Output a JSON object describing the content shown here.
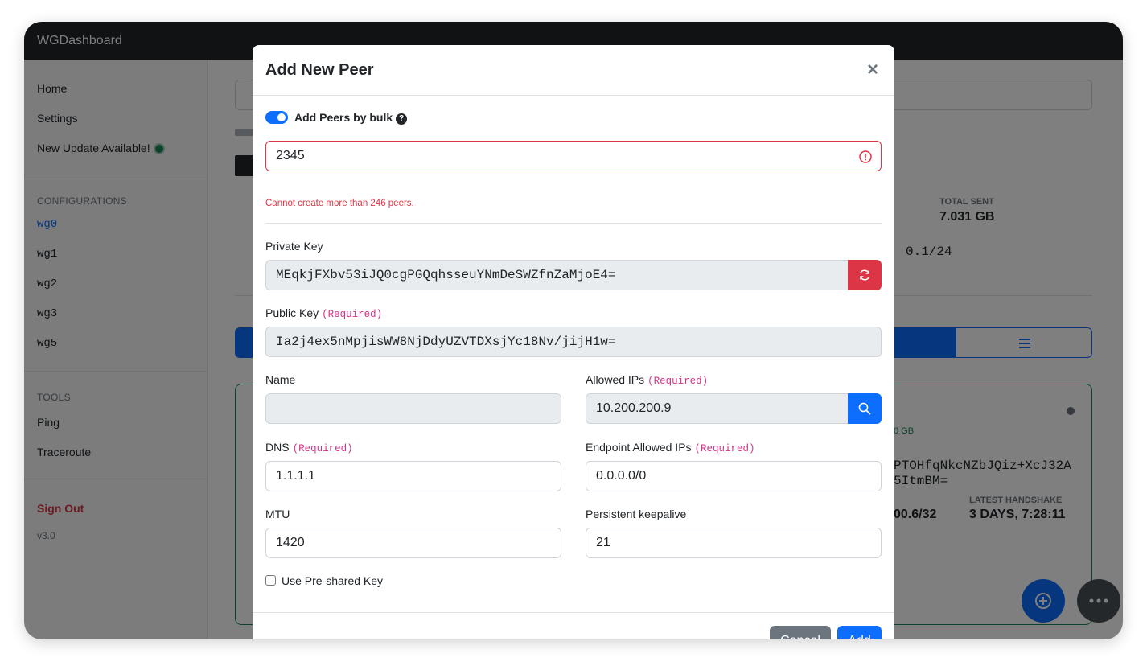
{
  "app": {
    "title": "WGDashboard"
  },
  "sidebar": {
    "home": "Home",
    "settings": "Settings",
    "update": "New Update Available!",
    "configurations_header": "CONFIGURATIONS",
    "configs": [
      "wg0",
      "wg1",
      "wg2",
      "wg3",
      "wg5"
    ],
    "tools_header": "TOOLS",
    "tools": [
      "Ping",
      "Traceroute"
    ],
    "sign_out": "Sign Out",
    "version": "v3.0"
  },
  "background": {
    "total_sent_label": "TOTAL SENT",
    "total_sent_value": "7.031 GB",
    "address_fragment": "0.1/24",
    "peer_key_line1": "PTOHfqNkcNZbJQiz+XcJ32A",
    "peer_key_line2": "5ItmBM=",
    "peer_usage": "0 GB",
    "peer_ip_fragment": "00.6/32",
    "latest_handshake_label": "LATEST HANDSHAKE",
    "latest_handshake_value": "3 DAYS, 7:28:11"
  },
  "modal": {
    "title": "Add New Peer",
    "close": "×",
    "bulk_label": "Add Peers by bulk",
    "bulk_help": "?",
    "bulk_value": "2345",
    "bulk_error": "Cannot create more than 246 peers.",
    "private_key_label": "Private Key",
    "private_key_value": "MEqkjFXbv53iJQ0cgPGQqhsseuYNmDeSWZfnZaMjoE4=",
    "public_key_label": "Public Key",
    "required": "(Required)",
    "public_key_value": "Ia2j4ex5nMpjisWW8NjDdyUZVTDXsjYc18Nv/jijH1w=",
    "name_label": "Name",
    "name_value": "",
    "allowed_ips_label": "Allowed IPs",
    "allowed_ips_value": "10.200.200.9",
    "dns_label": "DNS",
    "dns_value": "1.1.1.1",
    "endpoint_allowed_ips_label": "Endpoint Allowed IPs",
    "endpoint_allowed_ips_value": "0.0.0.0/0",
    "mtu_label": "MTU",
    "mtu_value": "1420",
    "keepalive_label": "Persistent keepalive",
    "keepalive_value": "21",
    "preshared_label": "Use Pre-shared Key",
    "cancel_label": "Cancel",
    "add_label": "Add"
  },
  "colors": {
    "primary": "#0d6efd",
    "danger": "#dc3545",
    "secondary": "#6c757d",
    "dark": "#212529",
    "required_pink": "#d63384"
  }
}
